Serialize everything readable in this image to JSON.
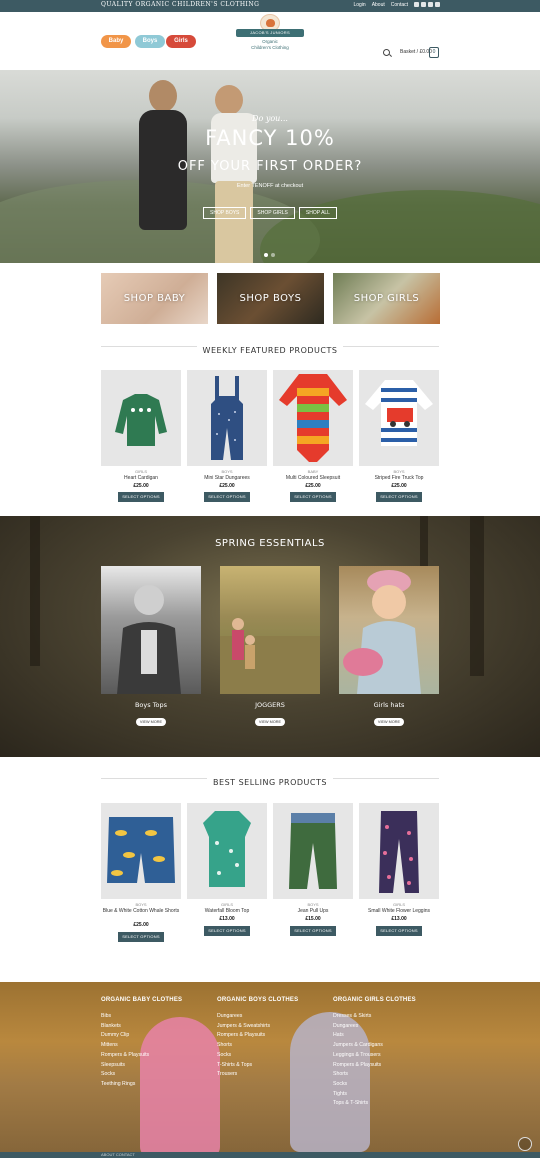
{
  "topbar": {
    "tagline": "Quality organic children's clothing",
    "links": [
      "Login",
      "About",
      "Contact"
    ],
    "social_icons": [
      "facebook-icon",
      "instagram-icon",
      "twitter-icon",
      "email-icon"
    ]
  },
  "header": {
    "nav": [
      "Baby",
      "Boys",
      "Girls"
    ],
    "logo_name": "Jacob's Juniors",
    "logo_sub": [
      "Organic",
      "Children's Clothing"
    ],
    "basket_label": "Basket / £0.00",
    "basket_count": "0"
  },
  "hero": {
    "intro": "Do you...",
    "headline": "FANCY 10%",
    "subheadline": "OFF YOUR FIRST ORDER?",
    "note": "Enter TENOFF at checkout",
    "buttons": [
      "SHOP BOYS",
      "SHOP GIRLS",
      "SHOP ALL"
    ]
  },
  "categories": [
    "SHOP BABY",
    "SHOP BOYS",
    "SHOP GIRLS"
  ],
  "featured": {
    "title": "Weekly Featured Products",
    "products": [
      {
        "category": "GIRLS",
        "name": "Heart Cardigan",
        "price": "£25.00",
        "button": "SELECT OPTIONS"
      },
      {
        "category": "BOYS",
        "name": "Mini Star Dungarees",
        "price": "£25.00",
        "button": "SELECT OPTIONS"
      },
      {
        "category": "BABY",
        "name": "Multi Coloured Sleepsuit",
        "price": "£25.00",
        "button": "SELECT OPTIONS"
      },
      {
        "category": "BOYS",
        "name": "Striped Fire Truck Top",
        "price": "£25.00",
        "button": "SELECT OPTIONS"
      }
    ]
  },
  "spring": {
    "title": "Spring Essentials",
    "cards": [
      {
        "label": "Boys Tops",
        "button": "VIEW MORE"
      },
      {
        "label": "JOGGERS",
        "button": "VIEW MORE"
      },
      {
        "label": "Girls hats",
        "button": "VIEW MORE"
      }
    ]
  },
  "bestselling": {
    "title": "Best Selling Products",
    "products": [
      {
        "category": "BOYS",
        "name": "Blue & White Cotton Whale Shorts",
        "price": "£25.00",
        "button": "SELECT OPTIONS"
      },
      {
        "category": "GIRLS",
        "name": "Waterfall Bloom Top",
        "price": "£13.00",
        "button": "SELECT OPTIONS"
      },
      {
        "category": "BOYS",
        "name": "Jean Pull Ups",
        "price": "£15.00",
        "button": "SELECT OPTIONS"
      },
      {
        "category": "GIRLS",
        "name": "Small White Flower Leggins",
        "price": "£13.00",
        "button": "SELECT OPTIONS"
      }
    ]
  },
  "footer": {
    "columns": [
      {
        "heading": "ORGANIC BABY CLOTHES",
        "items": [
          "Bibs",
          "Blankets",
          "Dummy Clip",
          "Mittens",
          "Rompers & Playsuits",
          "Sleepsuits",
          "Socks",
          "Teething Rings"
        ]
      },
      {
        "heading": "ORGANIC BOYS CLOTHES",
        "items": [
          "Dungarees",
          "Jumpers & Sweatshirts",
          "Rompers & Playsuits",
          "Shorts",
          "Socks",
          "T-Shirts & Tops",
          "Trousers"
        ]
      },
      {
        "heading": "ORGANIC GIRLS CLOTHES",
        "items": [
          "Dresses & Skirts",
          "Dungarees",
          "Hats",
          "Jumpers & Cardigans",
          "Leggings & Trousers",
          "Rompers & Playsuits",
          "Shorts",
          "Socks",
          "Tights",
          "Tops & T-Shirts"
        ]
      }
    ],
    "bottom_links": "ABOUT   CONTACT"
  },
  "colors": {
    "primary": "#3d5a63",
    "baby": "#f19548",
    "boys": "#8fc9d6",
    "girls": "#d64a3a"
  }
}
